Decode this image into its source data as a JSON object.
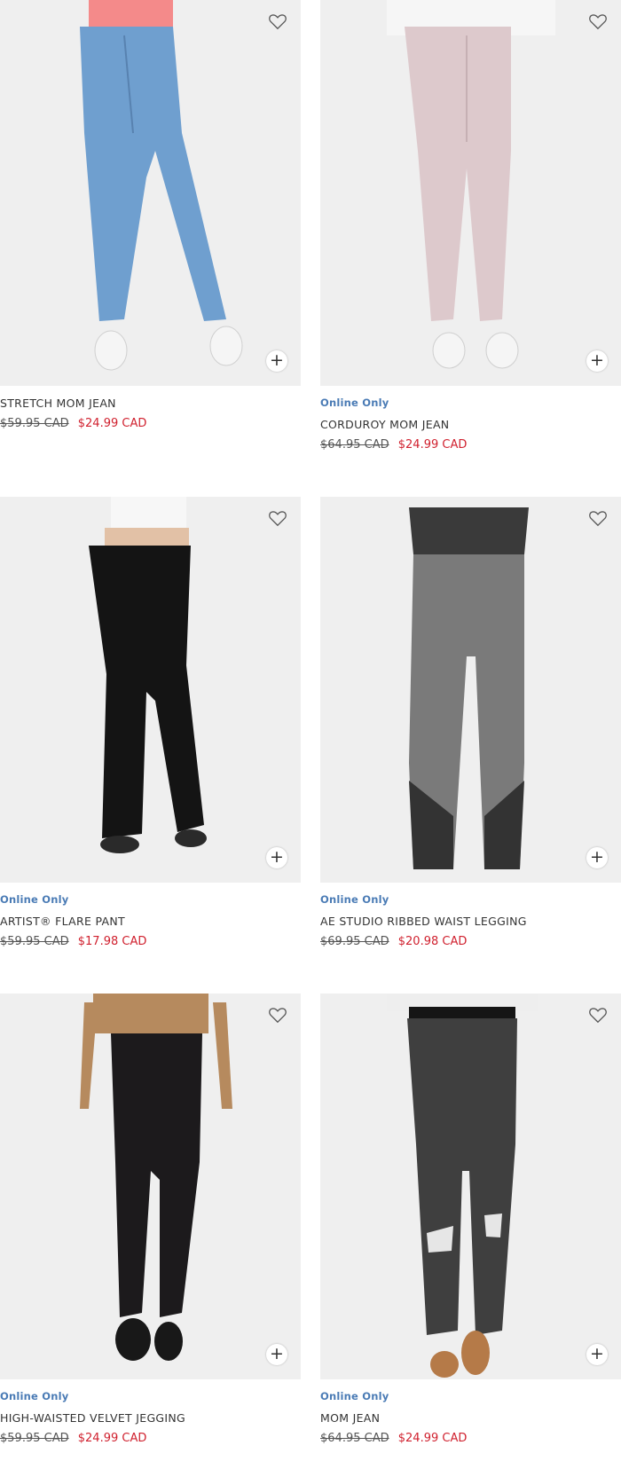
{
  "colors": {
    "badge": "#4a7bb5",
    "sale_price": "#d0212f",
    "text": "#333333",
    "image_bg": "#efefef"
  },
  "icons": {
    "wishlist": "heart-outline-icon",
    "quick_add": "plus-icon"
  },
  "products": [
    {
      "badge": "",
      "name": "STRETCH MOM JEAN",
      "original_price": "$59.95 CAD",
      "sale_price": "$24.99 CAD",
      "image": "light-wash-blue-jeans"
    },
    {
      "badge": "Online Only",
      "name": "CORDUROY MOM JEAN",
      "original_price": "$64.95 CAD",
      "sale_price": "$24.99 CAD",
      "image": "pale-pink-corduroy"
    },
    {
      "badge": "Online Only",
      "name": "ARTIST® FLARE PANT",
      "original_price": "$59.95 CAD",
      "sale_price": "$17.98 CAD",
      "image": "black-flare-pant"
    },
    {
      "badge": "Online Only",
      "name": "AE STUDIO RIBBED WAIST LEGGING",
      "original_price": "$69.95 CAD",
      "sale_price": "$20.98 CAD",
      "image": "grey-legging"
    },
    {
      "badge": "Online Only",
      "name": "HIGH-WAISTED VELVET JEGGING",
      "original_price": "$59.95 CAD",
      "sale_price": "$24.99 CAD",
      "image": "black-velvet-jegging"
    },
    {
      "badge": "Online Only",
      "name": "MOM JEAN",
      "original_price": "$64.95 CAD",
      "sale_price": "$24.99 CAD",
      "image": "black-ripped-mom-jean"
    }
  ]
}
